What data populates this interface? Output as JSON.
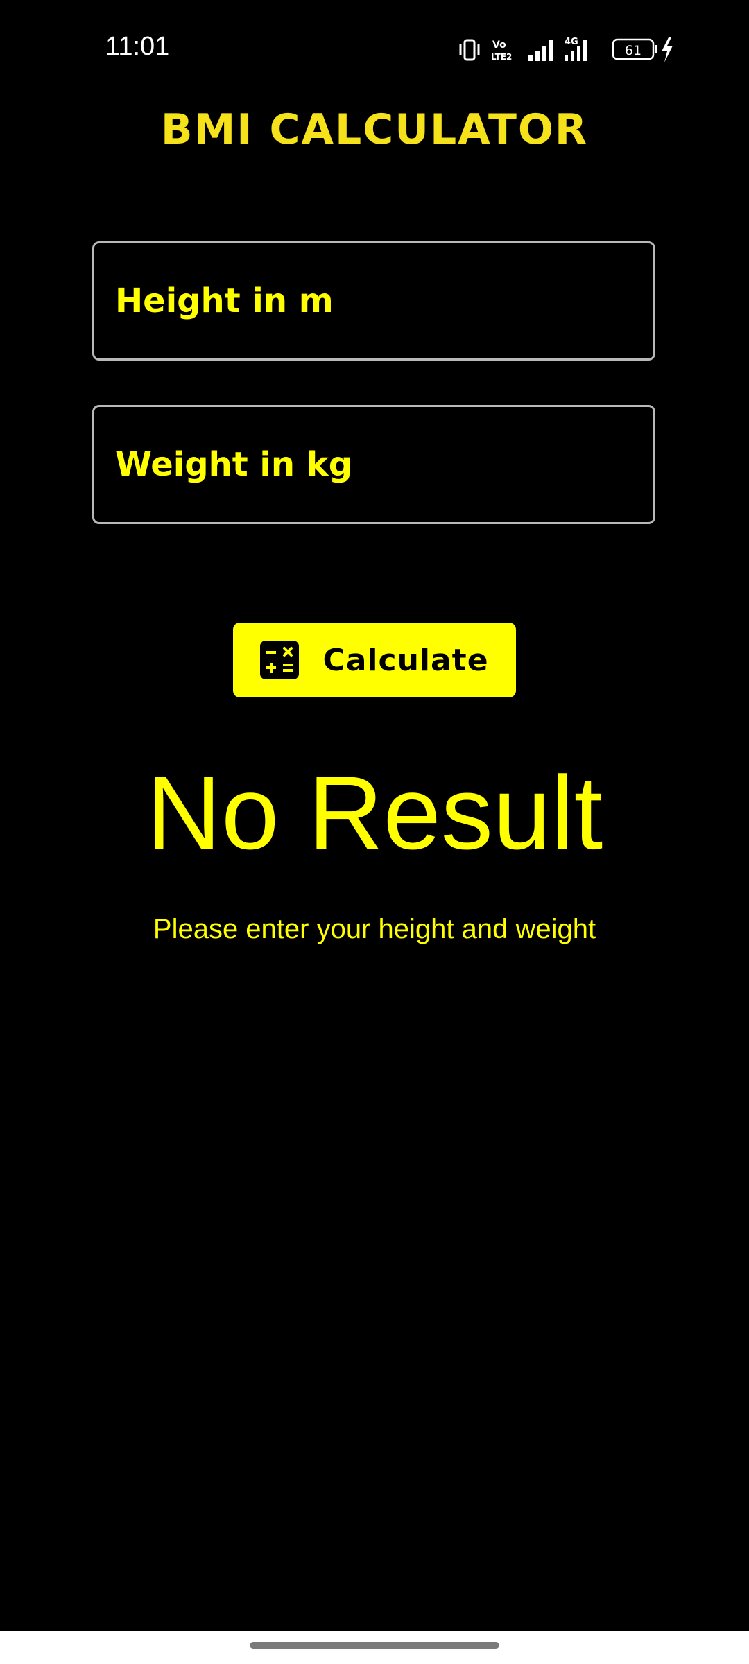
{
  "status_bar": {
    "time": "11:01",
    "network_label": "4G",
    "volte_label": "Vo LTE2",
    "battery_level": "61",
    "icons": [
      "vibrate-icon",
      "volte-icon",
      "signal-icon",
      "4g-signal-icon",
      "battery-icon",
      "charging-icon"
    ]
  },
  "app": {
    "title": "BMI CALCULATOR",
    "accent_color": "#ffff00",
    "background_color": "#000000"
  },
  "form": {
    "height_field": {
      "placeholder": "Height in m",
      "value": ""
    },
    "weight_field": {
      "placeholder": "Weight in kg",
      "value": ""
    },
    "calculate_button": {
      "label": "Calculate",
      "icon": "calculator-icon"
    }
  },
  "result": {
    "title": "No Result",
    "hint": "Please enter your height and weight"
  }
}
